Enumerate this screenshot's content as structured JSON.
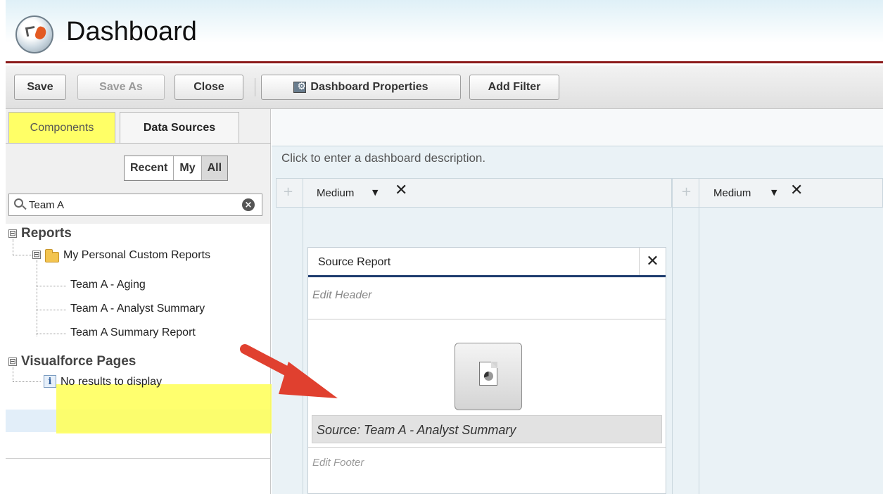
{
  "header": {
    "title": "Dashboard"
  },
  "toolbar": {
    "save": "Save",
    "save_as": "Save As",
    "close": "Close",
    "properties": "Dashboard Properties",
    "add_filter": "Add Filter"
  },
  "tabs": {
    "components": "Components",
    "data_sources": "Data Sources"
  },
  "filter": {
    "recent": "Recent",
    "my": "My",
    "all": "All"
  },
  "search": {
    "value": "Team A",
    "clear_icon": "×"
  },
  "tree": {
    "reports": "Reports",
    "folder": "My Personal Custom Reports",
    "items": [
      "Team A - Aging",
      "Team A - Analyst Summary",
      "Team A Summary Report"
    ],
    "visualforce": "Visualforce Pages",
    "no_results": "No results to display",
    "info_icon": "i",
    "toggle_icon": "⊟"
  },
  "canvas": {
    "description": "Click to enter a dashboard description.",
    "columns": [
      {
        "size": "Medium",
        "caret": "▼",
        "remove": "✕"
      },
      {
        "size": "Medium",
        "caret": "▼",
        "remove": "✕"
      }
    ],
    "plus": "+"
  },
  "component": {
    "title": "Source Report",
    "remove": "✕",
    "edit_header": "Edit Header",
    "source": "Source: Team A - Analyst Summary",
    "edit_footer": "Edit Footer"
  },
  "colors": {
    "header_rule": "#8b1a1a",
    "highlight": "#ffff55",
    "card_rule": "#1e3c6e",
    "arrow": "#e0402f"
  }
}
